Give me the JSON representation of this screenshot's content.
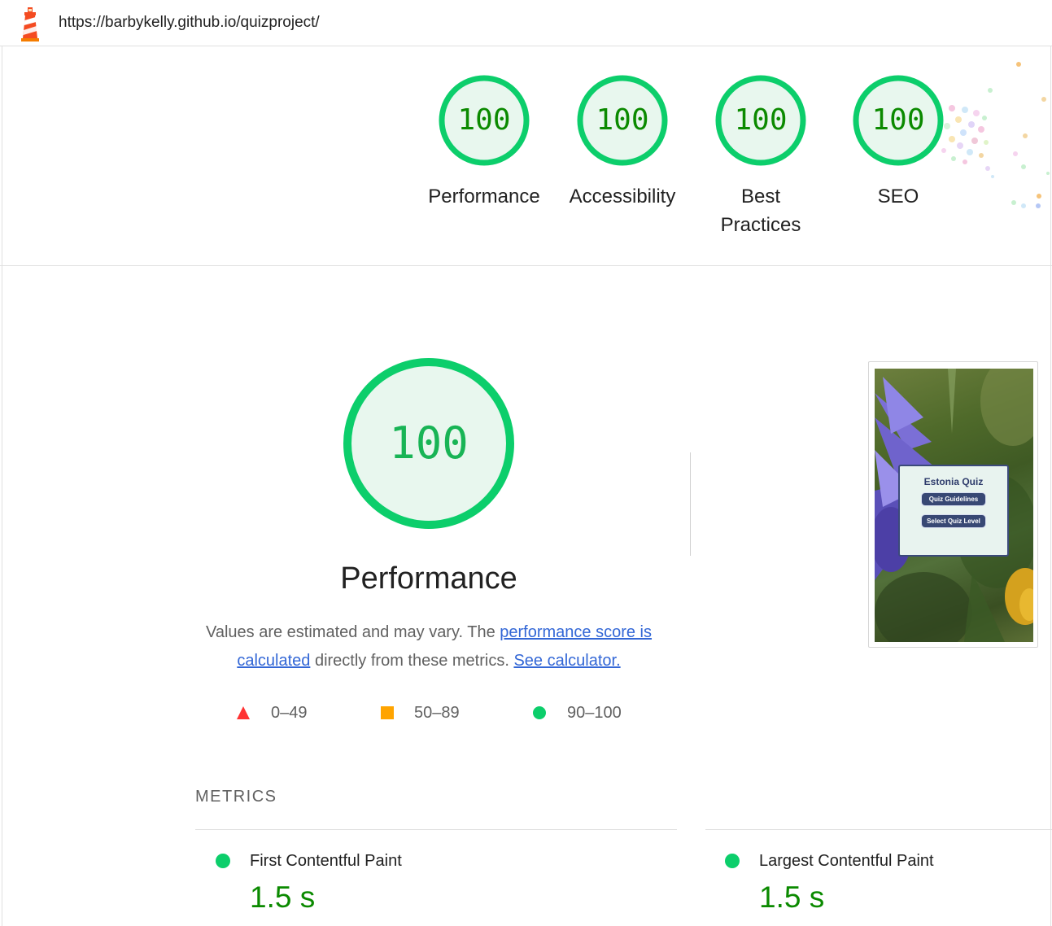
{
  "header": {
    "url": "https://barbykelly.github.io/quizproject/"
  },
  "colors": {
    "pass": "#0cce6b",
    "pass_text": "#0b8a00",
    "average": "#ffa400",
    "fail": "#ff3333",
    "link": "#3367d6"
  },
  "gauges": [
    {
      "score": "100",
      "label": "Performance"
    },
    {
      "score": "100",
      "label": "Accessibility"
    },
    {
      "score": "100",
      "label": "Best Practices"
    },
    {
      "score": "100",
      "label": "SEO"
    }
  ],
  "performance": {
    "score": "100",
    "title": "Performance",
    "desc_prefix": "Values are estimated and may vary. The ",
    "desc_link1": "performance score is calculated",
    "desc_middle": " directly from these metrics. ",
    "desc_link2": "See calculator."
  },
  "legend": [
    {
      "shape": "triangle-icon",
      "range": "0–49"
    },
    {
      "shape": "square-icon",
      "range": "50–89"
    },
    {
      "shape": "circle-icon",
      "range": "90–100"
    }
  ],
  "screenshot": {
    "quiz_title": "Estonia Quiz",
    "button1": "Quiz Guidelines",
    "button2": "Select Quiz Level"
  },
  "metrics": {
    "header": "METRICS",
    "items": [
      {
        "title": "First Contentful Paint",
        "value": "1.5 s"
      },
      {
        "title": "Largest Contentful Paint",
        "value": "1.5 s"
      }
    ]
  }
}
